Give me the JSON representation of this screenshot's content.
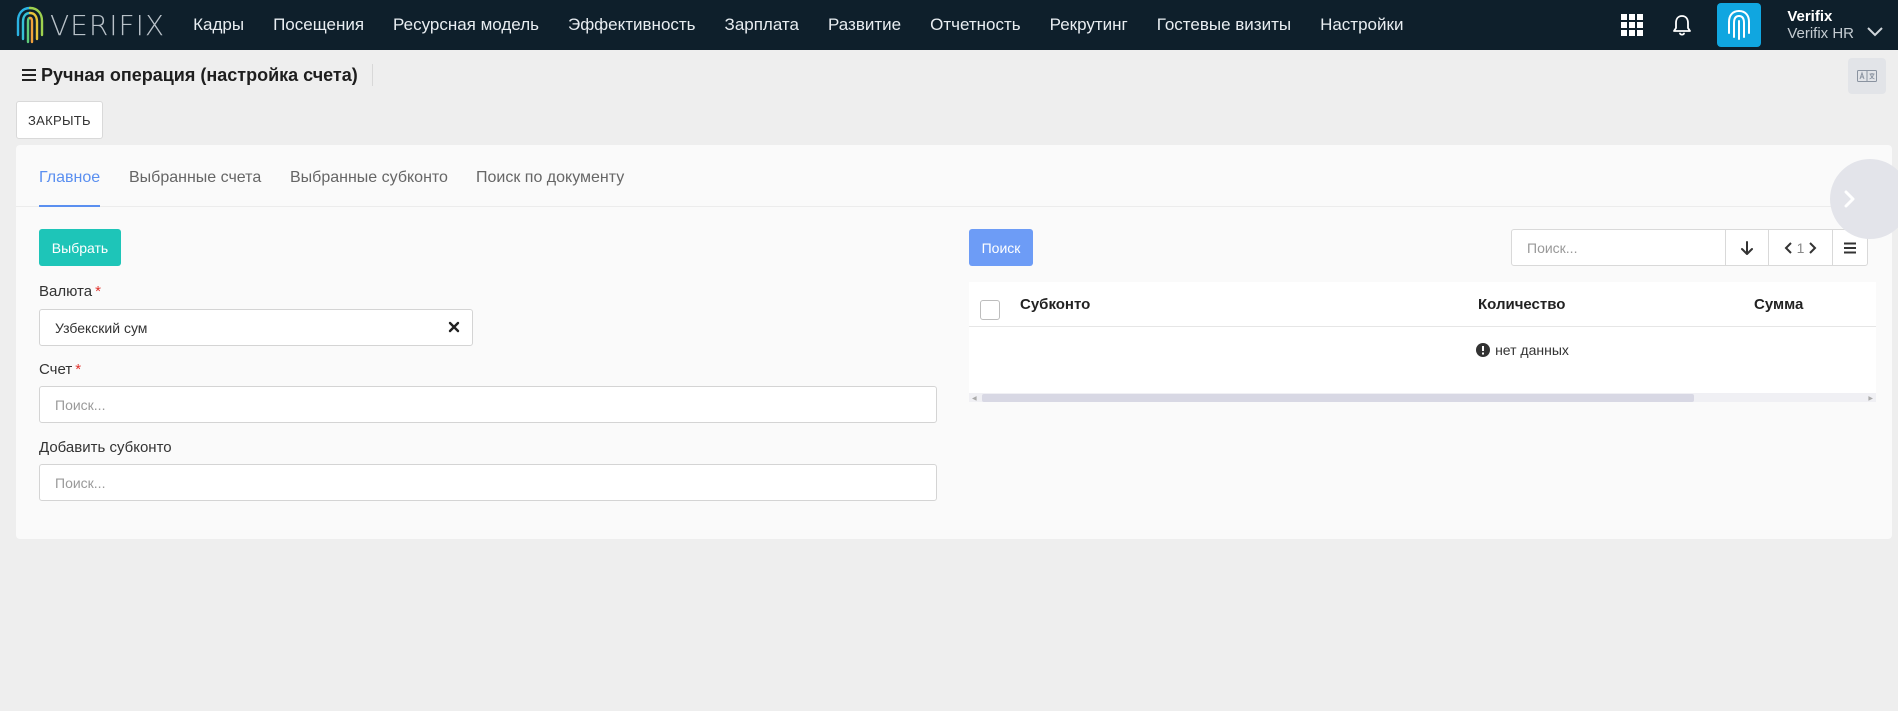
{
  "app": {
    "logo_text": "VERIFIX",
    "nav": [
      "Кадры",
      "Посещения",
      "Ресурсная модель",
      "Эффективность",
      "Зарплата",
      "Развитие",
      "Отчетность",
      "Рекрутинг",
      "Гостевые визиты",
      "Настройки"
    ],
    "user": {
      "name": "Verifix",
      "company": "Verifix HR"
    },
    "colors": {
      "navbar": "#0e1f2b",
      "accent_teal": "#1ec5b8",
      "accent_blue": "#6d9cf6",
      "tab_active": "#5a8ff0",
      "avatar_bg": "#10a6e0"
    }
  },
  "page": {
    "title": "Ручная операция (настройка счета)",
    "close_label": "ЗАКРЫТЬ"
  },
  "tabs": [
    "Главное",
    "Выбранные счета",
    "Выбранные субконто",
    "Поиск по документу"
  ],
  "form": {
    "select_label": "Выбрать",
    "currency": {
      "label": "Валюта",
      "required_mark": "*",
      "value": "Узбекский сум"
    },
    "account": {
      "label": "Счет",
      "required_mark": "*",
      "placeholder": "Поиск..."
    },
    "subconto": {
      "label": "Добавить субконто",
      "placeholder": "Поиск..."
    }
  },
  "grid": {
    "search_button": "Поиск",
    "search_placeholder": "Поиск...",
    "page_number": "1",
    "columns": [
      "Субконто",
      "Количество",
      "Сумма"
    ],
    "empty_text": "нет данных"
  }
}
